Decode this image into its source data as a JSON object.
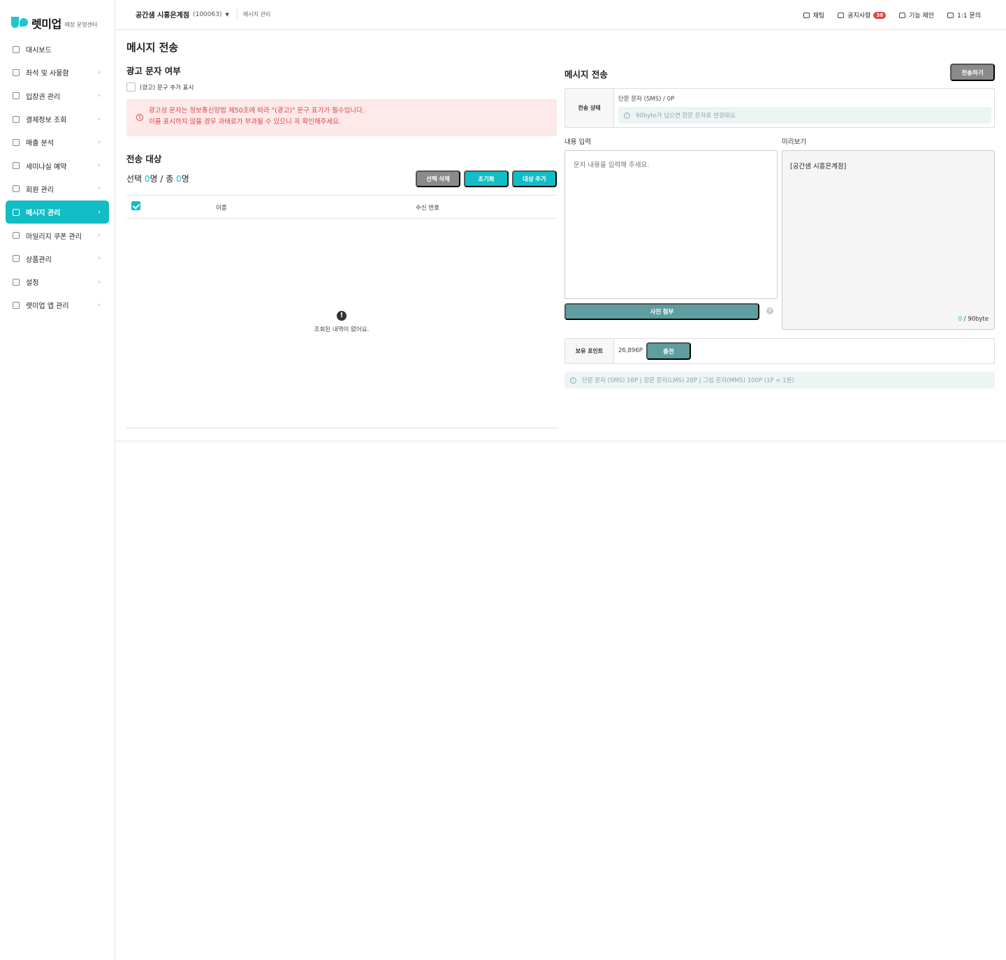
{
  "brand": {
    "name": "렛미업",
    "subtitle": "매장 운영센터"
  },
  "sidebar": {
    "items": [
      {
        "label": "대시보드",
        "icon": "grid-icon",
        "chevron": false
      },
      {
        "label": "좌석 및 사물함",
        "icon": "seat-icon",
        "chevron": true
      },
      {
        "label": "입장권 관리",
        "icon": "ticket-icon",
        "chevron": true
      },
      {
        "label": "결제정보 조회",
        "icon": "card-icon",
        "chevron": true
      },
      {
        "label": "매출 분석",
        "icon": "bar-chart-icon",
        "chevron": true
      },
      {
        "label": "세미나실 예약",
        "icon": "calendar-icon",
        "chevron": true
      },
      {
        "label": "회원 관리",
        "icon": "users-icon",
        "chevron": true
      },
      {
        "label": "메시지 관리",
        "icon": "mail-icon",
        "chevron": true,
        "active": true
      },
      {
        "label": "마일리지 쿠폰 관리",
        "icon": "coin-icon",
        "chevron": true
      },
      {
        "label": "상품관리",
        "icon": "bag-icon",
        "chevron": true
      },
      {
        "label": "설정",
        "icon": "gear-icon",
        "chevron": true
      },
      {
        "label": "렛미업 앱 관리",
        "icon": "apps-icon",
        "chevron": true
      }
    ],
    "chevron_glyph": "›"
  },
  "header": {
    "store_name": "공간샘 시흥은계점",
    "store_code": "(100063)",
    "caret": "▼",
    "breadcrumb": "메시지 관리",
    "menu": [
      {
        "label": "채팅",
        "icon": "chat-box-icon"
      },
      {
        "label": "공지사항",
        "icon": "bell-icon",
        "badge": "38"
      },
      {
        "label": "기능 제안",
        "icon": "comment-icon"
      },
      {
        "label": "1:1 문의",
        "icon": "speech-bubble-icon"
      }
    ]
  },
  "page": {
    "title": "메시지 전송",
    "ad_section": {
      "title": "광고 문자 여부",
      "checkbox_label": "(광고) 문구 추가 표시",
      "alert_icon": "!",
      "alert_line1": "광고성 문자는 정보통신망법 제50조에 따라 \"(광고)\" 문구 표기가 필수입니다.",
      "alert_line2": "이를 표시하지 않을 경우 과태료가 부과될 수 있으니 꼭 확인해주세요."
    },
    "target_section": {
      "title": "전송 대상",
      "count_prefix": "선택 ",
      "selected": "0",
      "count_mid": "명 / 총 ",
      "total": "0",
      "count_suffix": "명",
      "btn_delete": "선택 삭제",
      "btn_reset": "초기화",
      "btn_add": "대상 추가",
      "col_name": "이름",
      "col_phone": "수신 번호",
      "empty_icon": "!",
      "empty_text": "조회된 내역이 없어요."
    },
    "send_section": {
      "title": "메시지 전송",
      "btn_send": "전송하기",
      "status_label": "전송 상태",
      "status_text": "단문 문자 (SMS) / 0P",
      "status_info_icon": "i",
      "status_info": "90byte가 넘으면 장문 문자로 변경돼요.",
      "input_label": "내용 입력",
      "input_placeholder": "문자 내용을 입력해 주세요.",
      "preview_label": "미리보기",
      "preview_text": "[공간샘 시흥은계점]",
      "preview_bytes_used": "0",
      "preview_bytes_limit": " / 90byte",
      "btn_photo": "사진 첨부",
      "help_icon": "?",
      "points_label": "보유 포인트",
      "points_value": "26,896P",
      "btn_charge": "충전",
      "price_info_icon": "i",
      "price_info": "단문 문자 (SMS) 16P | 장문 문자(LMS) 28P | 그림 문자(MMS) 100P (1P = 1원)"
    }
  }
}
